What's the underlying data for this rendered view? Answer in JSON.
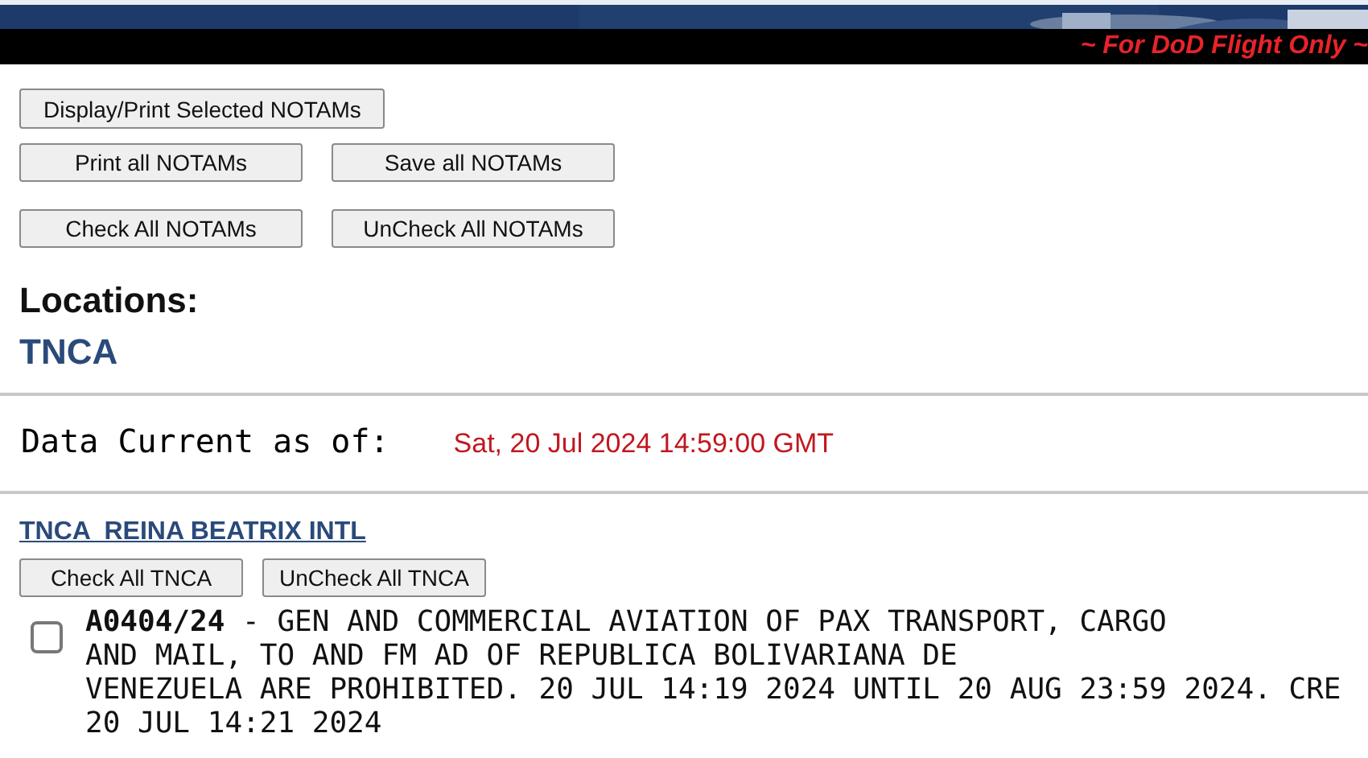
{
  "banner": {
    "notice": "~ For DoD Flight Only ~"
  },
  "actions": {
    "display": "Display/Print Selected NOTAMs",
    "row1": [
      "Print all NOTAMs",
      "Save all NOTAMs"
    ],
    "row2": [
      "Check All NOTAMs",
      "UnCheck All NOTAMs"
    ]
  },
  "locations": {
    "heading": "Locations:",
    "codes": [
      "TNCA"
    ]
  },
  "data_current": {
    "label": "Data Current as of:",
    "value": "Sat, 20 Jul 2024 14:59:00 GMT"
  },
  "airport": {
    "title": "TNCA  REINA BEATRIX INTL",
    "buttons": [
      "Check All TNCA",
      "UnCheck All TNCA"
    ],
    "notams": [
      {
        "checked": false,
        "lines": [
          "**A0404/24** - GEN AND COMMERCIAL AVIATION OF PAX TRANSPORT, CARGO",
          "AND MAIL, TO AND FM AD OF REPUBLICA BOLIVARIANA DE",
          "VENEZUELA ARE PROHIBITED. 20 JUL 14:19 2024 UNTIL 20 AUG 23:59 2024. CRE",
          "20 JUL 14:21 2024"
        ]
      }
    ]
  }
}
